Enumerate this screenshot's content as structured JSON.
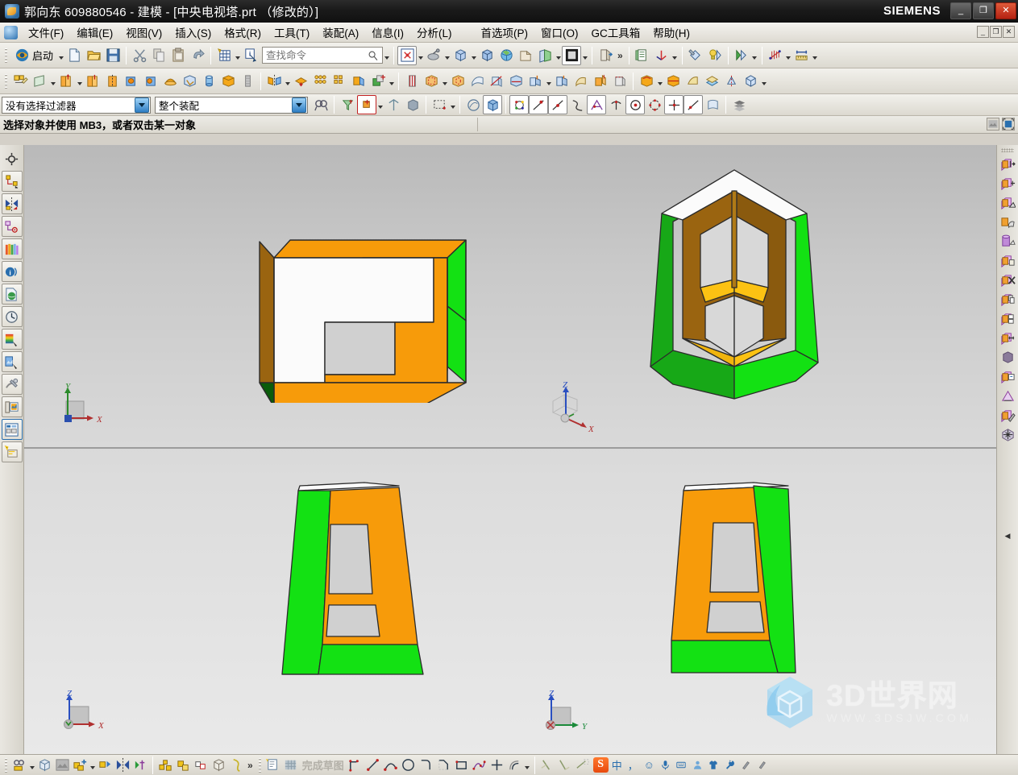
{
  "window": {
    "title": "郭向东 609880546 - 建模 - [中央电视塔.prt （修改的）]",
    "brand": "SIEMENS",
    "app_icon": "nx-logo-icon",
    "buttons": {
      "minimize": "_",
      "restore": "❐",
      "close": "✕"
    }
  },
  "menubar": {
    "items": [
      {
        "label": "文件(F)",
        "name": "menu-file"
      },
      {
        "label": "编辑(E)",
        "name": "menu-edit"
      },
      {
        "label": "视图(V)",
        "name": "menu-view"
      },
      {
        "label": "插入(S)",
        "name": "menu-insert"
      },
      {
        "label": "格式(R)",
        "name": "menu-format"
      },
      {
        "label": "工具(T)",
        "name": "menu-tools"
      },
      {
        "label": "装配(A)",
        "name": "menu-assemblies"
      },
      {
        "label": "信息(I)",
        "name": "menu-information"
      },
      {
        "label": "分析(L)",
        "name": "menu-analysis"
      },
      {
        "label": "首选项(P)",
        "name": "menu-preferences"
      },
      {
        "label": "窗口(O)",
        "name": "menu-window"
      },
      {
        "label": "GC工具箱",
        "name": "menu-gc-toolkit"
      },
      {
        "label": "帮助(H)",
        "name": "menu-help"
      }
    ],
    "mdi_buttons": [
      "_",
      "❐",
      "✕"
    ]
  },
  "toolbar_standard": {
    "start_label": "启动",
    "find_placeholder": "查找命令",
    "icons": [
      "start-icon",
      "new-file-icon",
      "open-folder-icon",
      "save-icon",
      "cut-scissors-icon",
      "copy-icon",
      "paste-icon",
      "undo-arrow-icon",
      "grid-snap-icon",
      "info-panel-icon",
      "search-icon",
      "fit-view-icon",
      "zoom-pan-icon",
      "rotate-cube-icon",
      "isometric-view-icon",
      "perspective-globe-icon",
      "shaded-edges-icon",
      "section-view-icon",
      "background-color-icon",
      "layer-visible-icon",
      "assembly-navigator-icon",
      "wcs-axis-icon",
      "material-brush-icon",
      "render-bulb-icon",
      "geometry-analysis-icon",
      "curve-analysis-icon",
      "measure-distance-icon"
    ]
  },
  "toolbar_feature": {
    "icons": [
      "sketch-icon",
      "datum-plane-icon",
      "extrude-icon",
      "revolve-icon",
      "revolve-axis-icon",
      "hole-icon",
      "boss-icon",
      "dome-icon",
      "pocket-icon",
      "cylinder-icon",
      "block-icon",
      "thread-icon",
      "mirror-feature-icon",
      "move-face-icon",
      "pattern-feature-icon",
      "pattern-geometry-icon",
      "offset-face-icon",
      "union-boolean-icon",
      "through-curve-icon",
      "swept-icon",
      "tube-icon",
      "surface-icon",
      "trim-body-icon",
      "divide-face-icon",
      "bridge-curve-icon",
      "sew-icon",
      "edge-blend-icon",
      "chamfer-icon",
      "draft-icon",
      "shell-icon",
      "thicken-icon",
      "taper-body-icon",
      "wave-link-icon"
    ]
  },
  "selection_bar": {
    "filter_value": "没有选择过滤器",
    "scope_value": "整个装配",
    "icons": [
      "find-object-icon",
      "select-filter-icon",
      "snap-point-icon",
      "select-feature-icon",
      "rectangle-select-icon",
      "shaded-select-icon",
      "solid-body-icon",
      "point-constructor-icon",
      "point-on-line-icon",
      "endpoint-icon",
      "control-point-icon",
      "intersection-point-icon",
      "arc-center-icon",
      "circle-center-icon",
      "quadrant-point-icon",
      "point-on-curve-icon",
      "midpoint-icon",
      "face-point-icon",
      "layer-settings-icon"
    ]
  },
  "status_bar": {
    "message": "选择对象并使用 MB3，或者双击某一对象",
    "right_buttons": [
      "snapshot-icon",
      "maximize-view-icon"
    ]
  },
  "left_rail": {
    "top_icon": "target-crosshair-icon",
    "items": [
      {
        "name": "rail-assembly-navigator",
        "icon": "assembly-navigator-icon"
      },
      {
        "name": "rail-constraint-navigator",
        "icon": "constraint-navigator-icon"
      },
      {
        "name": "rail-part-navigator",
        "icon": "part-navigator-icon"
      },
      {
        "name": "rail-reuse-library",
        "icon": "reuse-library-icon"
      },
      {
        "name": "rail-hd3d-tools",
        "icon": "hd3d-info-icon"
      },
      {
        "name": "rail-web-browser",
        "icon": "web-browser-icon"
      },
      {
        "name": "rail-history",
        "icon": "history-clock-icon"
      },
      {
        "name": "rail-system-materials",
        "icon": "material-palette-icon"
      },
      {
        "name": "rail-system-scenes",
        "icon": "system-scene-icon"
      },
      {
        "name": "rail-system-visual-effects",
        "icon": "visual-effects-icon"
      },
      {
        "name": "rail-view-manager",
        "icon": "view-manager-icon"
      },
      {
        "name": "rail-roles",
        "icon": "roles-layout-icon"
      },
      {
        "name": "rail-new-tab",
        "icon": "new-tab-icon"
      }
    ]
  },
  "right_rail": {
    "items": [
      {
        "name": "rrail-move-object",
        "icon": "move-object-icon"
      },
      {
        "name": "rrail-move-face",
        "icon": "move-face-icon"
      },
      {
        "name": "rrail-pull-face",
        "icon": "pull-face-icon"
      },
      {
        "name": "rrail-resize-face",
        "icon": "resize-face-icon"
      },
      {
        "name": "rrail-resize-blend",
        "icon": "resize-blend-icon"
      },
      {
        "name": "rrail-replace-face",
        "icon": "replace-face-icon"
      },
      {
        "name": "rrail-delete-face",
        "icon": "delete-face-icon"
      },
      {
        "name": "rrail-copy-face",
        "icon": "copy-face-icon"
      },
      {
        "name": "rrail-offset-region",
        "icon": "offset-region-icon"
      },
      {
        "name": "rrail-resize-length",
        "icon": "resize-length-icon"
      },
      {
        "name": "rrail-shell-body",
        "icon": "shell-body-icon"
      },
      {
        "name": "rrail-label-notch",
        "icon": "label-notch-icon"
      },
      {
        "name": "rrail-draft-face",
        "icon": "draft-face-icon"
      },
      {
        "name": "rrail-optimize-face",
        "icon": "optimize-face-icon"
      },
      {
        "name": "rrail-move-edge",
        "icon": "move-edge-icon"
      }
    ],
    "collapse_icon": "collapse-left-icon"
  },
  "viewport": {
    "layout": "four-view-quad",
    "views": [
      {
        "name": "view-top-left",
        "label": "",
        "triad": {
          "axes": [
            "Y",
            "X"
          ],
          "type": "xy-triad"
        }
      },
      {
        "name": "view-top-right",
        "label": "",
        "triad": {
          "axes": [
            "Z",
            "X"
          ],
          "type": "iso-triad"
        }
      },
      {
        "name": "view-bottom-left",
        "label": "",
        "triad": {
          "axes": [
            "Z",
            "X"
          ],
          "type": "xz-triad"
        }
      },
      {
        "name": "view-bottom-right",
        "label": "",
        "triad": {
          "axes": [
            "Z",
            "Y"
          ],
          "type": "yz-triad"
        }
      }
    ],
    "model_colors": {
      "orange": "#f79b0a",
      "green_bright": "#13e113",
      "green_mid": "#17a817",
      "green_dark": "#0a5c0a",
      "brown": "#9a6410",
      "gold": "#fcc213",
      "white": "#fbfbfb",
      "grey_face": "#d0d0d0",
      "edge": "#2b2b2b"
    }
  },
  "bottom_bar": {
    "dim_label": "完成草图",
    "icons": [
      "sketch-in-task-icon",
      "datum-csys-icon",
      "image-plane-icon",
      "add-component-icon",
      "mirror-assembly-icon",
      "assembly-constraint-icon",
      "component-pattern-icon",
      "explode-view-icon",
      "arrangement-icon",
      "wave-geometry-icon",
      "measure-icon",
      "finish-sketch-icon",
      "profile-icon",
      "line-icon",
      "arc-icon",
      "circle-icon",
      "fillet-icon",
      "chamfer-icon",
      "rectangle-icon",
      "point-icon",
      "quick-trim-icon",
      "quick-extend-icon",
      "offset-curve-icon",
      "dim-icon",
      "constraint-icon",
      "animate-dimension-icon"
    ],
    "overflow": "»"
  },
  "ime_bar": {
    "name": "sogou-ime-toolbar",
    "logo": "S",
    "buttons": [
      {
        "name": "ime-chinese-mode",
        "glyph": "中"
      },
      {
        "name": "ime-punctuation",
        "glyph": "，"
      },
      {
        "name": "ime-emoji",
        "glyph": "☺"
      },
      {
        "name": "ime-voice-input",
        "glyph": "🎤"
      },
      {
        "name": "ime-soft-keyboard",
        "glyph": "⌨"
      },
      {
        "name": "ime-user",
        "glyph": "👤"
      },
      {
        "name": "ime-skin",
        "glyph": "👕"
      },
      {
        "name": "ime-toolbox",
        "glyph": "🔧"
      },
      {
        "name": "ime-more-1",
        "glyph": "✎"
      },
      {
        "name": "ime-more-2",
        "glyph": "✑"
      }
    ]
  },
  "watermark": {
    "line1": "3D世界网",
    "line2": "WWW.3DSJW.COM",
    "logo": "hexagon-cube-icon",
    "color": "#8ecdf0"
  }
}
